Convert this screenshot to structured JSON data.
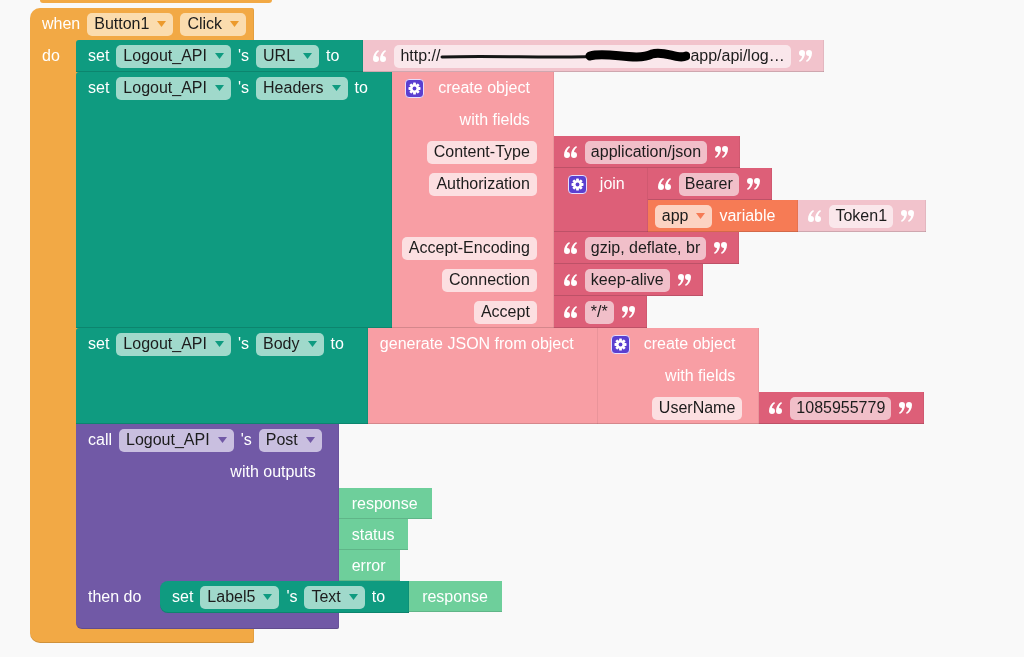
{
  "event_block": {
    "keyword": "when",
    "component": "Button1",
    "event": "Click",
    "do_label": "do",
    "statements": [
      {
        "kind": "set_property",
        "keyword": "set",
        "component": "Logout_API",
        "possessive": "'s",
        "property": "URL",
        "to_label": "to",
        "value": {
          "kind": "text",
          "color": "#f2c3cc",
          "text_parts": [
            "http://",
            "app/api/log…"
          ],
          "redacted": true
        }
      },
      {
        "kind": "set_property",
        "keyword": "set",
        "component": "Logout_API",
        "possessive": "'s",
        "property": "Headers",
        "to_label": "to",
        "value": {
          "kind": "create_object",
          "title": "create object",
          "subtitle": "with fields",
          "fields": [
            {
              "key": "Content-Type",
              "value": {
                "kind": "text",
                "color": "#dd5f78",
                "text": "application/json"
              }
            },
            {
              "key": "Authorization",
              "value": {
                "kind": "join",
                "title": "join",
                "items": [
                  {
                    "kind": "text",
                    "color": "#dd5f78",
                    "text": "Bearer"
                  },
                  {
                    "kind": "app_variable",
                    "scope": "app",
                    "label": "variable",
                    "name": {
                      "kind": "text",
                      "color": "#f2c3cc",
                      "text": "Token1"
                    }
                  }
                ]
              }
            },
            {
              "key": "Accept-Encoding",
              "value": {
                "kind": "text",
                "color": "#dd5f78",
                "text": "gzip, deflate, br"
              }
            },
            {
              "key": "Connection",
              "value": {
                "kind": "text",
                "color": "#dd5f78",
                "text": "keep-alive"
              }
            },
            {
              "key": "Accept",
              "value": {
                "kind": "text",
                "color": "#dd5f78",
                "text": "*/*"
              }
            }
          ]
        }
      },
      {
        "kind": "set_property",
        "keyword": "set",
        "component": "Logout_API",
        "possessive": "'s",
        "property": "Body",
        "to_label": "to",
        "value": {
          "kind": "generate_json",
          "title": "generate JSON from object",
          "object": {
            "kind": "create_object",
            "title": "create object",
            "subtitle": "with fields",
            "fields": [
              {
                "key": "UserName",
                "value": {
                  "kind": "text",
                  "color": "#dd5f78",
                  "text": "1085955779"
                }
              }
            ]
          }
        }
      },
      {
        "kind": "call_method",
        "keyword": "call",
        "component": "Logout_API",
        "possessive": "'s",
        "method": "Post",
        "outputs_label": "with outputs",
        "outputs": [
          {
            "kind": "getter",
            "name": "response"
          },
          {
            "kind": "getter",
            "name": "status"
          },
          {
            "kind": "getter",
            "name": "error"
          }
        ],
        "then_label": "then do",
        "then_statements": [
          {
            "kind": "set_property",
            "keyword": "set",
            "component": "Label5",
            "possessive": "'s",
            "property": "Text",
            "to_label": "to",
            "value": {
              "kind": "getter",
              "name": "response"
            }
          }
        ]
      }
    ]
  }
}
